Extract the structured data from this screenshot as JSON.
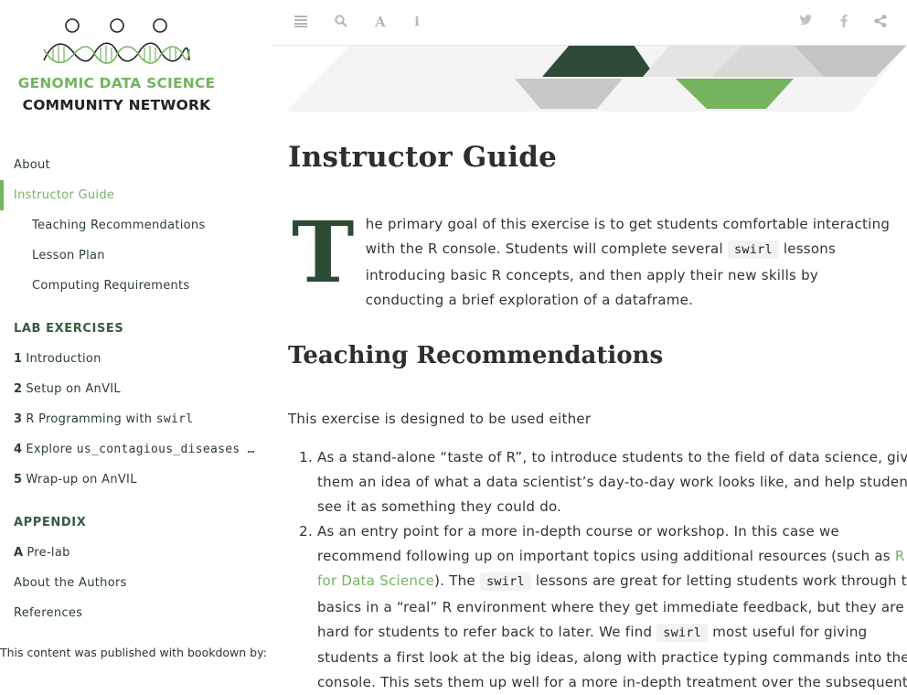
{
  "logo": {
    "line1": "GENOMIC DATA SCIENCE",
    "line2": "COMMUNITY NETWORK"
  },
  "nav": {
    "about": "About",
    "instructor_guide": "Instructor Guide",
    "teaching_recs": "Teaching Recommendations",
    "lesson_plan": "Lesson Plan",
    "computing_reqs": "Computing Requirements",
    "lab_header": "LAB EXERCISES",
    "lab_items": [
      {
        "num": "1",
        "label": "Introduction",
        "code": ""
      },
      {
        "num": "2",
        "label": "Setup on AnVIL",
        "code": ""
      },
      {
        "num": "3",
        "label": "R Programming with ",
        "code": "swirl"
      },
      {
        "num": "4",
        "label": "Explore ",
        "code": "us_contagious_diseases …"
      },
      {
        "num": "5",
        "label": "Wrap-up on AnVIL",
        "code": ""
      }
    ],
    "appendix_header": "APPENDIX",
    "appendix_item": {
      "num": "A",
      "label": "Pre-lab"
    },
    "about_authors": "About the Authors",
    "references": "References",
    "published": "This content was published with bookdown by:"
  },
  "toolbar": {
    "icons": [
      "menu-icon",
      "search-icon",
      "font-icon",
      "info-icon",
      "twitter-icon",
      "facebook-icon",
      "share-icon"
    ]
  },
  "content": {
    "title": "Instructor Guide",
    "dropcap": "T",
    "intro_1": "he primary goal of this exercise is to get students comfortable interacting with the R console. Students will complete several ",
    "intro_code": "swirl",
    "intro_2": " lessons introducing basic R concepts, and then apply their new skills by conducting a brief exploration of a dataframe.",
    "h2": "Teaching Recommendations",
    "para": "This exercise is designed to be used either",
    "li1": "As a stand-alone “taste of R”, to introduce students to the field of data science, give them an idea of what a data scientist’s day-to-day work looks like, and help students see it as something they could do.",
    "li2_a": "As an entry point for a more in-depth course or workshop. In this case we recommend following up on important topics using additional resources (such as ",
    "li2_link": "R for Data Science",
    "li2_b": "). The ",
    "li2_code1": "swirl",
    "li2_c": " lessons are great for letting students work through the basics in a “real” R environment where they get immediate feedback, but they are hard for students to refer back to later. We find ",
    "li2_code2": "swirl",
    "li2_d": " most useful for giving students a first look at the big ideas, along with practice typing commands into the console. This sets them up well for a more in-depth treatment over the subsequent"
  },
  "colors": {
    "accent": "#74b45f",
    "dark_green": "#2d4a35"
  }
}
